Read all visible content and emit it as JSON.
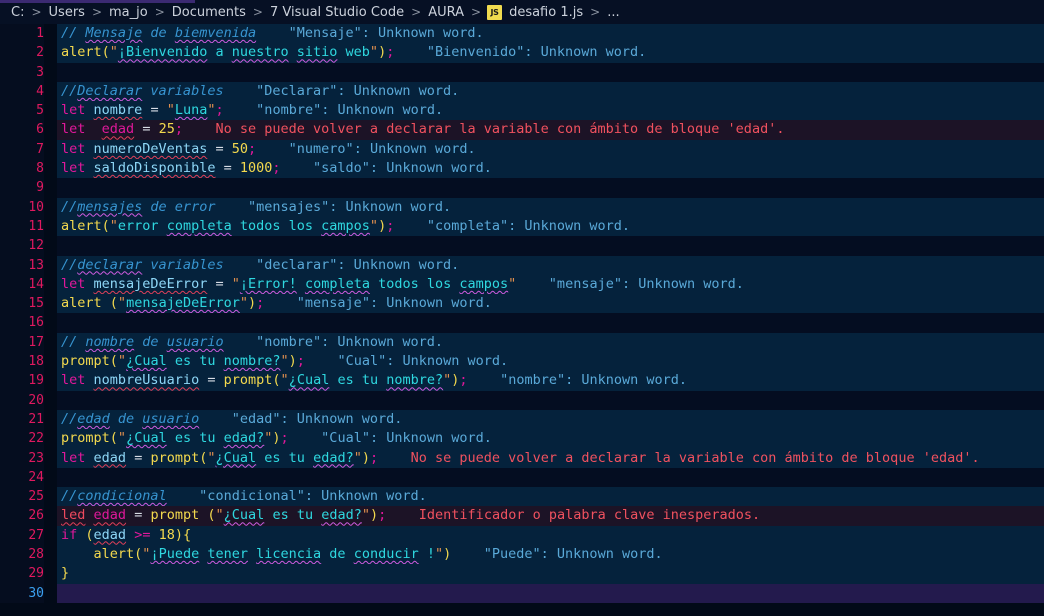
{
  "breadcrumb": {
    "name": "file-path-breadcrumb",
    "separator": ">",
    "file_icon_label": "JS",
    "items": [
      "C:",
      "Users",
      "ma_jo",
      "Documents",
      "7 Visual Studio Code",
      "AURA"
    ],
    "file_name": "desafio 1.js",
    "tail": "..."
  },
  "editor": {
    "language": "javascript",
    "total_lines": 30,
    "active_line": 30,
    "colors": {
      "editor_background": "#020a18",
      "line_background": "#05223c",
      "empty_line_background": "#040d21",
      "error_line_background": "#1c1326",
      "active_line_background": "#231a4d",
      "gutter_background": "#050d1f",
      "line_number": "#e0195f",
      "active_line_number": "#3aa0f0",
      "comment": "#3794d0",
      "keyword": "#e0189a",
      "variable": "#8ed7f7",
      "function": "#f3d94e",
      "string": "#e08f4e",
      "string_text": "#2fd8e0",
      "number": "#f3d94e",
      "inlay_hint": "#5aa9d8",
      "error_text": "#f0515f",
      "spell_squiggle": "#cf5ce0",
      "error_squiggle": "#e0405a"
    },
    "lines": [
      {
        "n": 1,
        "bg": "code",
        "text": "// Mensaje de biemvenida",
        "hint": "\"Mensaje\": Unknown word."
      },
      {
        "n": 2,
        "bg": "code",
        "text": "alert(\"¡Bienvenido a nuestro sitio web\");",
        "hint": "\"Bienvenido\": Unknown word."
      },
      {
        "n": 3,
        "bg": "empty",
        "text": "",
        "hint": ""
      },
      {
        "n": 4,
        "bg": "code",
        "text": "//Declarar variables",
        "hint": "\"Declarar\": Unknown word."
      },
      {
        "n": 5,
        "bg": "code",
        "text": "let nombre = \"Luna\";",
        "hint": "\"nombre\": Unknown word."
      },
      {
        "n": 6,
        "bg": "err",
        "text": "let  edad = 25;",
        "hint": "No se puede volver a declarar la variable con ámbito de bloque 'edad'."
      },
      {
        "n": 7,
        "bg": "code",
        "text": "let numeroDeVentas = 50;",
        "hint": "\"numero\": Unknown word."
      },
      {
        "n": 8,
        "bg": "code",
        "text": "let saldoDisponible = 1000;",
        "hint": "\"saldo\": Unknown word."
      },
      {
        "n": 9,
        "bg": "empty",
        "text": "",
        "hint": ""
      },
      {
        "n": 10,
        "bg": "code",
        "text": "//mensajes de error",
        "hint": "\"mensajes\": Unknown word."
      },
      {
        "n": 11,
        "bg": "code",
        "text": "alert(\"error completa todos los campos\");",
        "hint": "\"completa\": Unknown word."
      },
      {
        "n": 12,
        "bg": "empty",
        "text": "",
        "hint": ""
      },
      {
        "n": 13,
        "bg": "code",
        "text": "//declarar variables",
        "hint": "\"declarar\": Unknown word."
      },
      {
        "n": 14,
        "bg": "code",
        "text": "let mensajeDeError = \"¡Error! completa todos los campos\"",
        "hint": "\"mensaje\": Unknown word."
      },
      {
        "n": 15,
        "bg": "code",
        "text": "alert (\"mensajeDeError\");",
        "hint": "\"mensaje\": Unknown word."
      },
      {
        "n": 16,
        "bg": "empty",
        "text": "",
        "hint": ""
      },
      {
        "n": 17,
        "bg": "code",
        "text": "// nombre de usuario",
        "hint": "\"nombre\": Unknown word."
      },
      {
        "n": 18,
        "bg": "code",
        "text": "prompt(\"¿Cual es tu nombre?\");",
        "hint": "\"Cual\": Unknown word."
      },
      {
        "n": 19,
        "bg": "code",
        "text": "let nombreUsuario = prompt(\"¿Cual es tu nombre?\");",
        "hint": "\"nombre\": Unknown word."
      },
      {
        "n": 20,
        "bg": "empty",
        "text": "",
        "hint": ""
      },
      {
        "n": 21,
        "bg": "code",
        "text": "//edad de usuario",
        "hint": "\"edad\": Unknown word."
      },
      {
        "n": 22,
        "bg": "code",
        "text": "prompt(\"¿Cual es tu edad?\");",
        "hint": "\"Cual\": Unknown word."
      },
      {
        "n": 23,
        "bg": "code",
        "text": "let edad = prompt(\"¿Cual es tu edad?\");",
        "hint": "No se puede volver a declarar la variable con ámbito de bloque 'edad'."
      },
      {
        "n": 24,
        "bg": "empty",
        "text": "",
        "hint": ""
      },
      {
        "n": 25,
        "bg": "code",
        "text": "//condicional",
        "hint": "\"condicional\": Unknown word."
      },
      {
        "n": 26,
        "bg": "err",
        "text": "led edad = prompt (\"¿Cual es tu edad?\");",
        "hint": "Identificador o palabra clave inesperados."
      },
      {
        "n": 27,
        "bg": "code",
        "text": "if (edad >= 18){",
        "hint": ""
      },
      {
        "n": 28,
        "bg": "code",
        "text": "    alert(\"¡Puede tener licencia de conducir !\")",
        "hint": "\"Puede\": Unknown word."
      },
      {
        "n": 29,
        "bg": "code",
        "text": "}",
        "hint": ""
      },
      {
        "n": 30,
        "bg": "sel",
        "text": "",
        "hint": ""
      }
    ]
  }
}
